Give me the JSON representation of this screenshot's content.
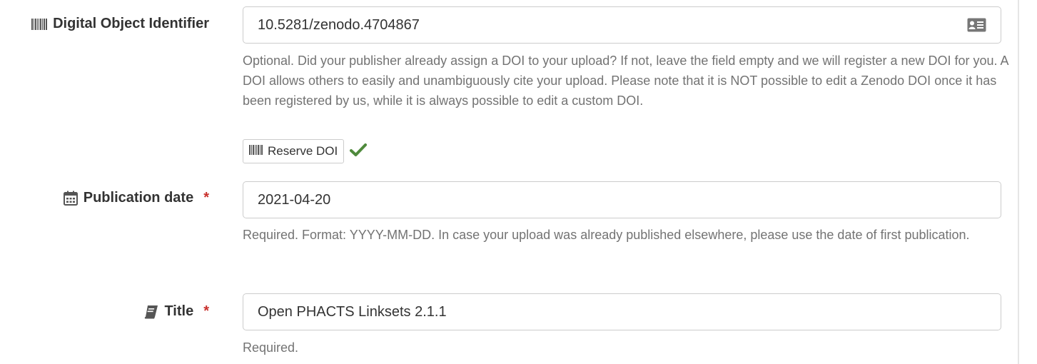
{
  "doi": {
    "label": "Digital Object Identifier",
    "value": "10.5281/zenodo.4704867",
    "help": "Optional. Did your publisher already assign a DOI to your upload? If not, leave the field empty and we will register a new DOI for you. A DOI allows others to easily and unambiguously cite your upload. Please note that it is NOT possible to edit a Zenodo DOI once it has been registered by us, while it is always possible to edit a custom DOI.",
    "reserve_button_label": "Reserve DOI",
    "icons": {
      "label": "barcode-icon",
      "field": "id-card-icon",
      "button": "barcode-icon",
      "status": "checkmark-icon"
    },
    "status_color": "#4f8a3c"
  },
  "publication_date": {
    "label": "Publication date",
    "required_mark": "*",
    "value": "2021-04-20",
    "help": "Required. Format: YYYY-MM-DD. In case your upload was already published elsewhere, please use the date of first publication.",
    "icon": "calendar-icon"
  },
  "title": {
    "label": "Title",
    "required_mark": "*",
    "value": "Open PHACTS Linksets 2.1.1",
    "help": "Required.",
    "icon": "book-icon"
  },
  "colors": {
    "required": "#c9302c",
    "help_text": "#737373",
    "border": "#cccccc"
  }
}
